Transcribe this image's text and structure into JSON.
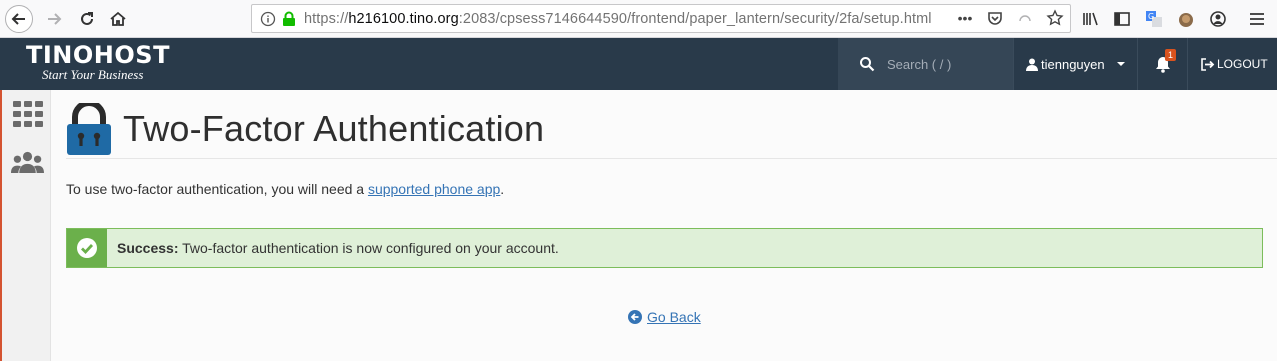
{
  "browser": {
    "url_scheme": "https://",
    "url_host": "h216100.tino.org",
    "url_rest": ":2083/cpsess7146644590/frontend/paper_lantern/security/2fa/setup.html",
    "more_label": "•••"
  },
  "header": {
    "brand_name": "TINOHOST",
    "brand_tagline": "Start Your Business",
    "search_placeholder": "Search ( / )",
    "username": "tiennguyen",
    "notification_count": "1",
    "logout_label": "LOGOUT"
  },
  "main": {
    "page_title": "Two-Factor Authentication",
    "intro_prefix": "To use two-factor authentication, you will need a ",
    "intro_link": "supported phone app",
    "intro_suffix": ".",
    "alert_strong": "Success:",
    "alert_text": " Two-factor authentication is now configured on your account.",
    "go_back_label": "Go Back"
  },
  "colors": {
    "header_bg": "#293a4a",
    "success_bg": "#dff0d8",
    "success_icon_bg": "#6bb04b",
    "link": "#3574b5",
    "lock_blue": "#1f6aa5"
  }
}
